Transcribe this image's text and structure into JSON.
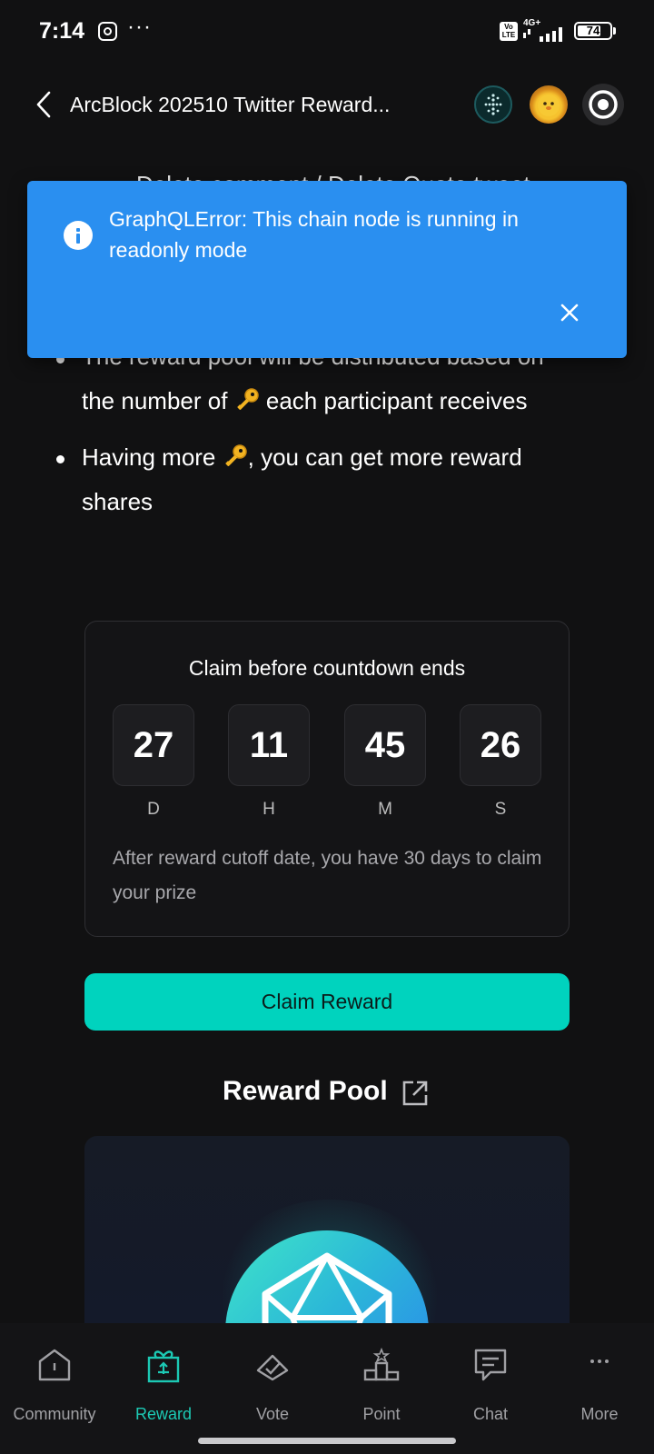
{
  "status_bar": {
    "time": "7:14",
    "network": "4G+",
    "battery": "74",
    "battery_level": 0.74
  },
  "header": {
    "title": "ArcBlock 202510 Twitter Reward..."
  },
  "content": {
    "partial_top": "Delete comment / Delete Quote tweet",
    "bullets": [
      {
        "line1": "The reward pool will be distributed based on",
        "line2_pre": "the number of ",
        "line2_post": " each participant receives"
      },
      {
        "line1_pre": "Having more ",
        "line1_post": ", you can get more reward",
        "line2": "shares"
      }
    ]
  },
  "banner": {
    "message": "GraphQLError: This chain node is running in readonly mode"
  },
  "countdown": {
    "title": "Claim before countdown ends",
    "units": [
      {
        "value": "27",
        "label": "D"
      },
      {
        "value": "11",
        "label": "H"
      },
      {
        "value": "45",
        "label": "M"
      },
      {
        "value": "26",
        "label": "S"
      }
    ],
    "note": "After reward cutoff date, you have 30 days to claim your prize"
  },
  "claim_button": "Claim Reward",
  "pool": {
    "title": "Reward Pool"
  },
  "nav": [
    {
      "label": "Community",
      "icon": "community-icon"
    },
    {
      "label": "Reward",
      "icon": "gift-icon",
      "active": true
    },
    {
      "label": "Vote",
      "icon": "vote-icon"
    },
    {
      "label": "Point",
      "icon": "podium-icon"
    },
    {
      "label": "Chat",
      "icon": "chat-icon"
    },
    {
      "label": "More",
      "icon": "more-icon"
    }
  ],
  "colors": {
    "accent": "#00d3be",
    "banner": "#2a8ff0",
    "background": "#111112"
  }
}
